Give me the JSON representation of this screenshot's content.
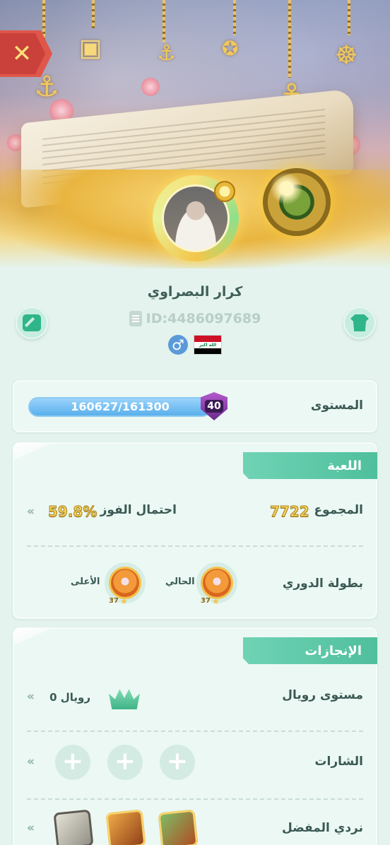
{
  "header": {
    "close_icon": "close-x-icon",
    "username": "كرار البصراوي",
    "user_id": "ID:4486097689",
    "gender_symbol": "♂",
    "flag_country": "Iraq",
    "flag_text": "الله اكبر"
  },
  "level": {
    "label": "المستوى",
    "progress_text": "160627/161300",
    "progress_fraction": 0.9958,
    "level_number": "40"
  },
  "game": {
    "title": "اللعبة",
    "total_label": "المجموع",
    "total_value": "7722",
    "win_label": "احتمال الفوز",
    "win_value": "59.8%",
    "league_label": "بطولة الدوري",
    "current_label": "الحالي",
    "current_rank": "37",
    "highest_label": "الأعلى",
    "highest_rank": "37"
  },
  "achievements": {
    "title": "الإنجازات",
    "royal_label": "مستوى رويال",
    "royal_value": "رويال 0",
    "badges_label": "الشارات",
    "plus_symbol": "+",
    "dice_label": "نردي المفضل"
  },
  "icons": {
    "chevron": "«"
  },
  "colors": {
    "accent": "#4fbf9c",
    "background": "#e4f3ee",
    "close": "#e0564a",
    "level_bar": "#5aa9e8",
    "gold": "#f5d35a"
  }
}
